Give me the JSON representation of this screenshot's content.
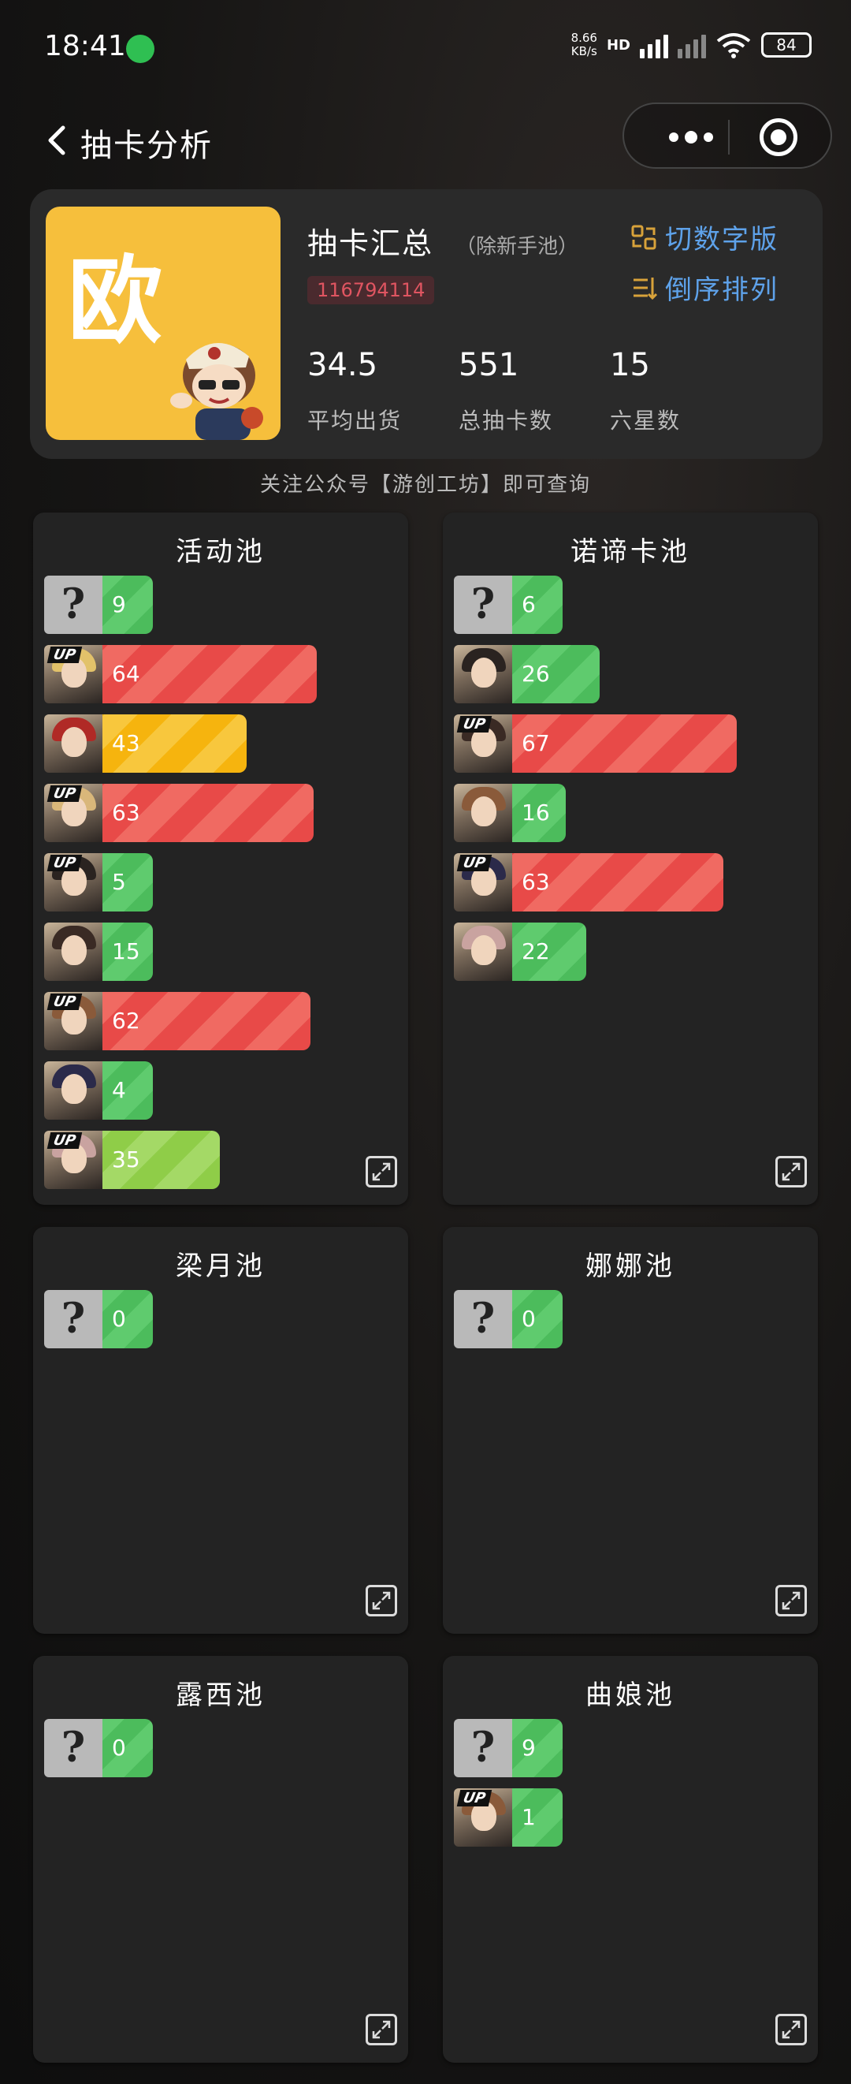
{
  "status_bar": {
    "time": "18:41",
    "net_speed_value": "8.66",
    "net_speed_unit": "KB/s",
    "hd": "HD",
    "battery": "84"
  },
  "nav": {
    "title": "抽卡分析",
    "icons": [
      "back-icon",
      "more-icon",
      "target-icon"
    ]
  },
  "summary": {
    "avatar_text": "欧",
    "title": "抽卡汇总",
    "subtitle": "（除新手池）",
    "uid": "116794114",
    "actions": {
      "switch_label": "切数字版",
      "sort_label": "倒序排列"
    },
    "stats": [
      {
        "value": "34.5",
        "label": "平均出货"
      },
      {
        "value": "551",
        "label": "总抽卡数"
      },
      {
        "value": "15",
        "label": "六星数"
      }
    ]
  },
  "notice": "关注公众号【游创工坊】即可查询",
  "colors": {
    "green": "#4cbc5c",
    "red": "#e84a48",
    "yellow": "#f6b40e",
    "lime": "#8fcd48",
    "link_blue": "#5ea2ea",
    "uid_red": "#e05561",
    "avatar_yellow": "#f6bf3c"
  },
  "pools": [
    {
      "title": "活动池",
      "entries": [
        {
          "kind": "unknown",
          "up": false,
          "count": 9,
          "color": "green"
        },
        {
          "kind": "char",
          "up": true,
          "count": 64,
          "color": "red"
        },
        {
          "kind": "char",
          "up": false,
          "count": 43,
          "color": "yellow"
        },
        {
          "kind": "char",
          "up": true,
          "count": 63,
          "color": "red"
        },
        {
          "kind": "char",
          "up": true,
          "count": 5,
          "color": "green"
        },
        {
          "kind": "char",
          "up": false,
          "count": 15,
          "color": "green"
        },
        {
          "kind": "char",
          "up": true,
          "count": 62,
          "color": "red"
        },
        {
          "kind": "char",
          "up": false,
          "count": 4,
          "color": "green"
        },
        {
          "kind": "char",
          "up": true,
          "count": 35,
          "color": "lime"
        }
      ]
    },
    {
      "title": "诺谛卡池",
      "entries": [
        {
          "kind": "unknown",
          "up": false,
          "count": 6,
          "color": "green"
        },
        {
          "kind": "char",
          "up": false,
          "count": 26,
          "color": "green"
        },
        {
          "kind": "char",
          "up": true,
          "count": 67,
          "color": "red"
        },
        {
          "kind": "char",
          "up": false,
          "count": 16,
          "color": "green"
        },
        {
          "kind": "char",
          "up": true,
          "count": 63,
          "color": "red"
        },
        {
          "kind": "char",
          "up": false,
          "count": 22,
          "color": "green"
        }
      ]
    },
    {
      "title": "梁月池",
      "entries": [
        {
          "kind": "unknown",
          "up": false,
          "count": 0,
          "color": "green"
        }
      ]
    },
    {
      "title": "娜娜池",
      "entries": [
        {
          "kind": "unknown",
          "up": false,
          "count": 0,
          "color": "green"
        }
      ]
    },
    {
      "title": "露西池",
      "entries": [
        {
          "kind": "unknown",
          "up": false,
          "count": 0,
          "color": "green"
        }
      ]
    },
    {
      "title": "曲娘池",
      "entries": [
        {
          "kind": "unknown",
          "up": false,
          "count": 9,
          "color": "green"
        },
        {
          "kind": "char",
          "up": true,
          "count": 1,
          "color": "green"
        }
      ]
    }
  ]
}
